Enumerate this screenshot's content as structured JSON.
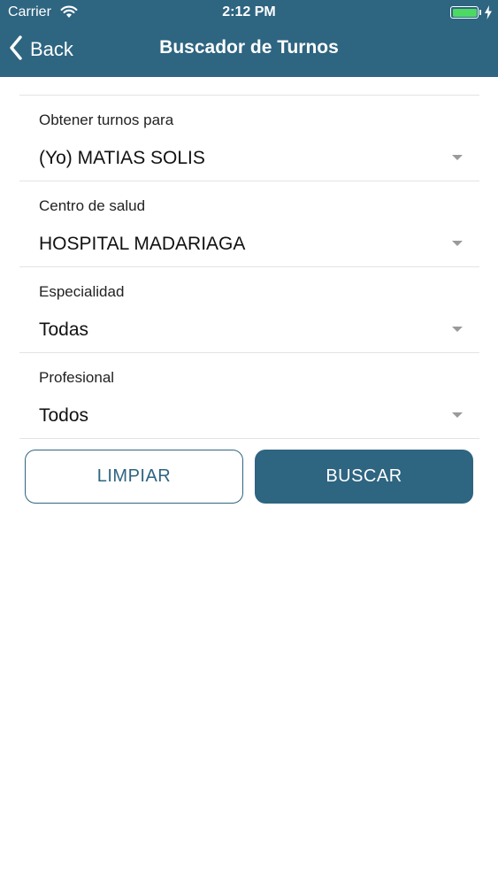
{
  "status_bar": {
    "carrier": "Carrier",
    "time": "2:12 PM"
  },
  "nav": {
    "back_label": "Back",
    "title": "Buscador de Turnos"
  },
  "form": {
    "fields": [
      {
        "label": "Obtener turnos para",
        "value": "(Yo) MATIAS SOLIS"
      },
      {
        "label": "Centro de salud",
        "value": "HOSPITAL MADARIAGA"
      },
      {
        "label": "Especialidad",
        "value": "Todas"
      },
      {
        "label": "Profesional",
        "value": "Todos"
      }
    ]
  },
  "buttons": {
    "clear_label": "LIMPIAR",
    "search_label": "BUSCAR"
  },
  "colors": {
    "header_bg": "#2e6581",
    "accent": "#2e6581",
    "battery": "#4cd964"
  }
}
